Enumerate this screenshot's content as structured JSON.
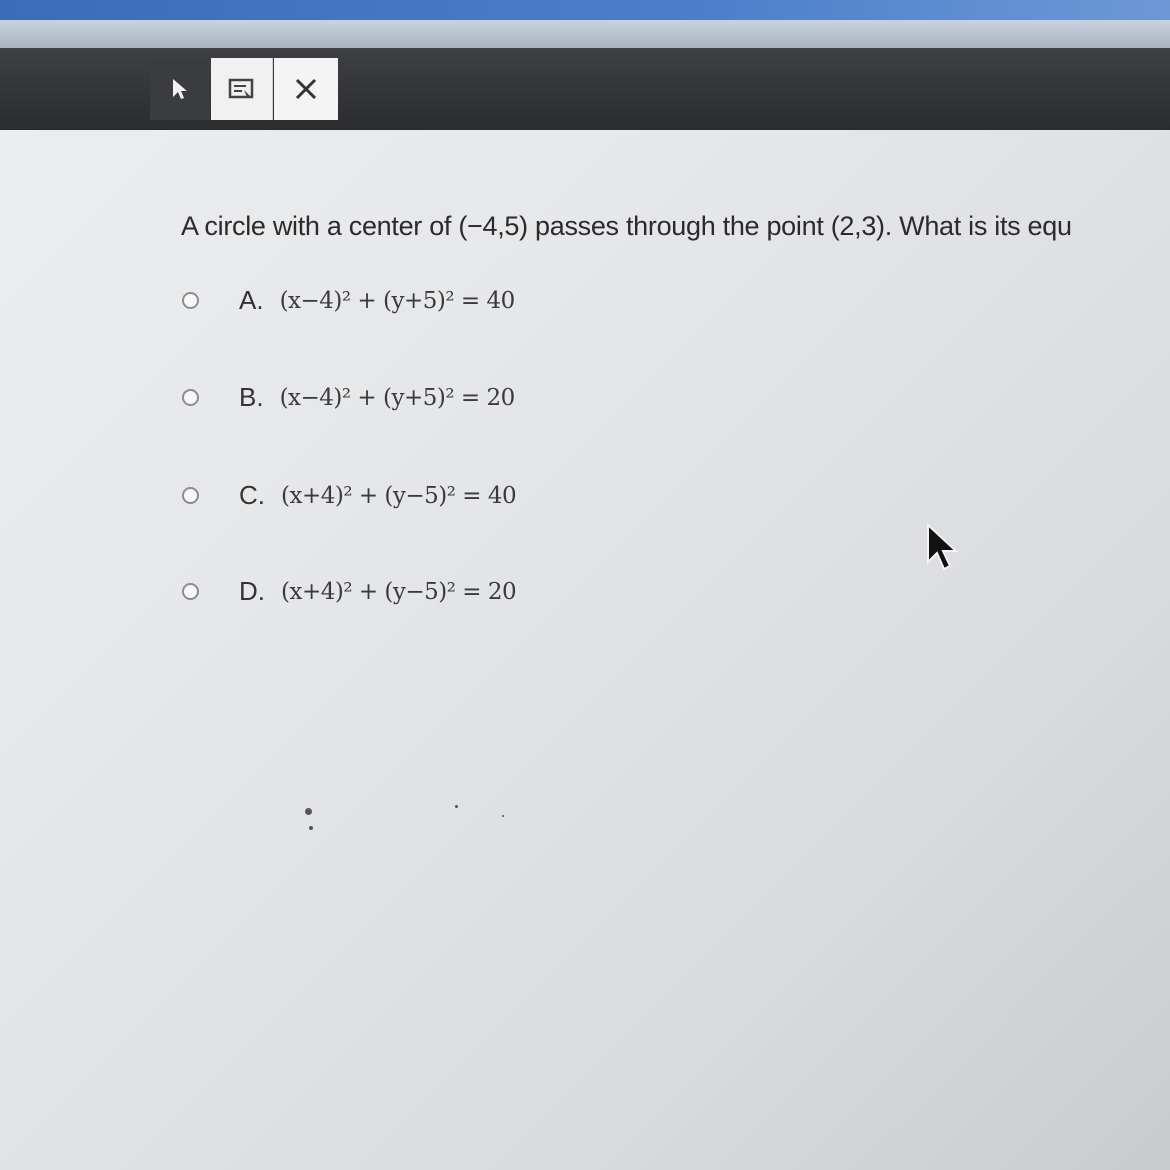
{
  "toolbar": {
    "tools": [
      {
        "id": "pointer",
        "icon": "pointer-arrow-icon"
      },
      {
        "id": "notepad",
        "icon": "notepad-icon"
      },
      {
        "id": "close",
        "icon": "close-icon",
        "glyph": "✕"
      }
    ]
  },
  "question": {
    "text": "A circle with a center of (−4,5) passes through the point (2,3). What is its equ"
  },
  "options": [
    {
      "letter": "A.",
      "equation": "(x−4)² + (y+5)² = 40"
    },
    {
      "letter": "B.",
      "equation": "(x−4)² + (y+5)² = 20"
    },
    {
      "letter": "C.",
      "equation": "(x+4)² + (y−5)² = 40"
    },
    {
      "letter": "D.",
      "equation": "(x+4)² + (y−5)² = 20"
    }
  ],
  "colors": {
    "toolbar_bg": "#333437",
    "top_strip": "#4b7fcb",
    "page_bg": "#e4e6e9"
  }
}
